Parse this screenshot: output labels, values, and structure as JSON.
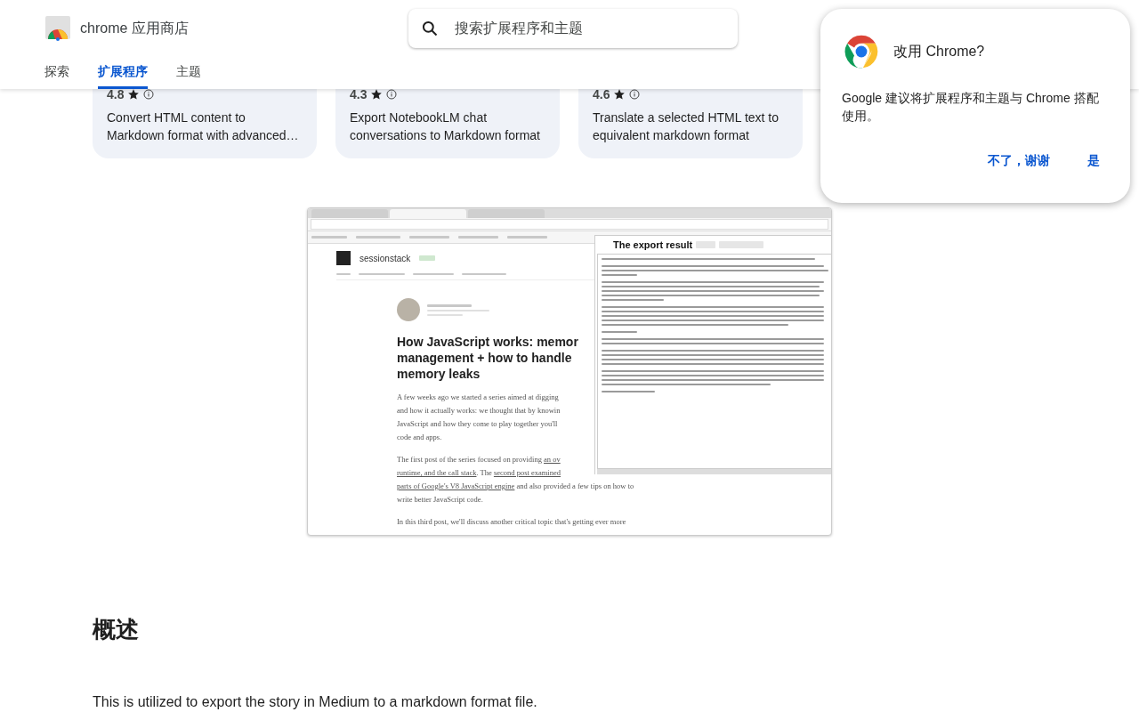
{
  "header": {
    "store_name": "chrome 应用商店",
    "search": {
      "placeholder": "搜索扩展程序和主题"
    },
    "tabs": [
      {
        "label": "探索",
        "selected": false
      },
      {
        "label": "扩展程序",
        "selected": true
      },
      {
        "label": "主题",
        "selected": false
      }
    ]
  },
  "cards": [
    {
      "rating": "4.8",
      "description": "Convert HTML content to Markdown format with advanced…"
    },
    {
      "rating": "4.3",
      "description": "Export NotebookLM chat conversations to Markdown format"
    },
    {
      "rating": "4.6",
      "description": "Translate a selected HTML text to equivalent markdown format"
    }
  ],
  "screenshot": {
    "site": {
      "name": "sessionstack"
    },
    "article": {
      "title_lines": [
        "How JavaScript works: memor",
        "management + how to handle",
        "memory leaks"
      ],
      "paragraphs": [
        [
          [
            {
              "text": "A few weeks ago we started a series aimed at digging",
              "link": false
            }
          ],
          [
            {
              "text": "and how it actually works: we thought that by knowin",
              "link": false
            }
          ],
          [
            {
              "text": "JavaScript and how they come to play together you'll",
              "link": false
            }
          ],
          [
            {
              "text": "code and apps.",
              "link": false
            }
          ]
        ],
        [
          [
            {
              "text": "The first post of the series focused on providing ",
              "link": false
            },
            {
              "text": "an ov",
              "link": true
            }
          ],
          [
            {
              "text": "runtime, and the call stack",
              "link": true
            },
            {
              "text": ". The ",
              "link": false
            },
            {
              "text": "second post examined",
              "link": true
            }
          ],
          [
            {
              "text": "parts of Google's V8 JavaScript engine",
              "link": true
            },
            {
              "text": " and also provided a few tips on how to",
              "link": false
            }
          ],
          [
            {
              "text": "write better JavaScript code.",
              "link": false
            }
          ]
        ],
        [
          [
            {
              "text": "In this third post, we'll discuss another critical topic that's getting ever more",
              "link": false
            }
          ]
        ]
      ]
    },
    "export_panel": {
      "title": "The export result"
    }
  },
  "overview": {
    "heading": "概述",
    "paragraphs": [
      "This is utilized to export the story in Medium to a markdown format file."
    ]
  },
  "popup": {
    "title": "改用 Chrome?",
    "body": "Google 建议将扩展程序和主题与 Chrome 搭配使用。",
    "buttons": [
      "不了，谢谢",
      "是"
    ]
  }
}
